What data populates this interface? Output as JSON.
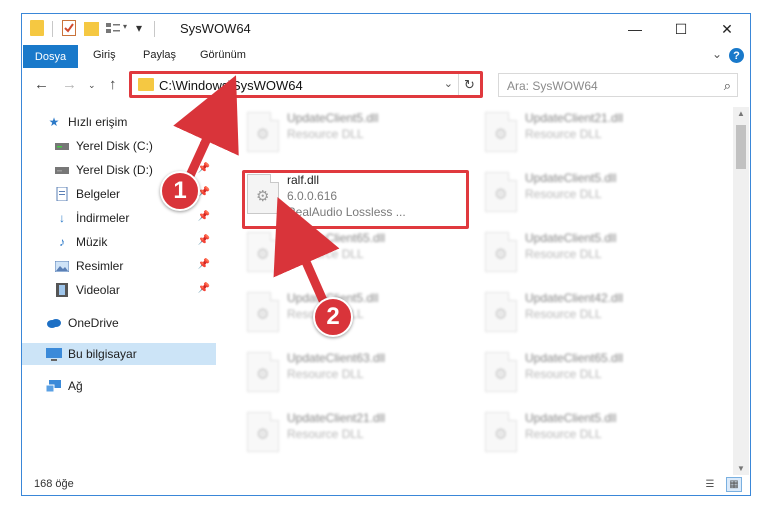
{
  "window": {
    "title": "SysWOW64",
    "buttons": {
      "minimize": "—",
      "maximize": "☐",
      "close": "✕"
    }
  },
  "ribbon": {
    "tabs": [
      "Dosya",
      "Giriş",
      "Paylaş",
      "Görünüm"
    ],
    "help_label": "?"
  },
  "address": {
    "path": "C:\\Windows\\SysWOW64",
    "search_placeholder": "Ara: SysWOW64"
  },
  "sidebar": {
    "items": [
      {
        "label": "Hızlı erişim",
        "icon": "star-icon"
      },
      {
        "label": "Yerel Disk (C:)",
        "icon": "drive-icon",
        "pinned": true
      },
      {
        "label": "Yerel Disk (D:)",
        "icon": "drive-icon",
        "pinned": true
      },
      {
        "label": "Belgeler",
        "icon": "documents-icon",
        "pinned": true
      },
      {
        "label": "İndirmeler",
        "icon": "download-icon",
        "pinned": true
      },
      {
        "label": "Müzik",
        "icon": "music-icon",
        "pinned": true
      },
      {
        "label": "Resimler",
        "icon": "pictures-icon",
        "pinned": true
      },
      {
        "label": "Videolar",
        "icon": "video-icon",
        "pinned": true
      },
      {
        "label": "OneDrive",
        "icon": "cloud-icon"
      },
      {
        "label": "Bu bilgisayar",
        "icon": "computer-icon",
        "selected": true
      },
      {
        "label": "Ağ",
        "icon": "network-icon"
      }
    ]
  },
  "files": {
    "highlighted": {
      "name": "ralf.dll",
      "version": "6.0.0.616",
      "description": "RealAudio Lossless ..."
    },
    "left_column": [
      {
        "name": "UpdateClient5.dll",
        "type": "Resource DLL"
      },
      {
        "name": "UpdateClient65.dll",
        "type": "Resource DLL"
      },
      {
        "name": "UpdateClient5.dll",
        "type": "Resource DLL"
      },
      {
        "name": "UpdateClient63.dll",
        "type": "Resource DLL"
      },
      {
        "name": "UpdateClient21.dll",
        "type": "Resource DLL"
      }
    ],
    "right_column": [
      {
        "name": "UpdateClient21.dll",
        "type": "Resource DLL"
      },
      {
        "name": "UpdateClient5.dll",
        "type": "Resource DLL"
      },
      {
        "name": "UpdateClient5.dll",
        "type": "Resource DLL"
      },
      {
        "name": "UpdateClient42.dll",
        "type": "Resource DLL"
      },
      {
        "name": "UpdateClient65.dll",
        "type": "Resource DLL"
      },
      {
        "name": "UpdateClient5.dll",
        "type": "Resource DLL"
      }
    ]
  },
  "status": {
    "item_count": "168 öğe"
  },
  "callouts": {
    "one": "1",
    "two": "2"
  },
  "colors": {
    "accent": "#1979ca",
    "highlight": "#e0393e",
    "selected": "#cce4f7"
  }
}
